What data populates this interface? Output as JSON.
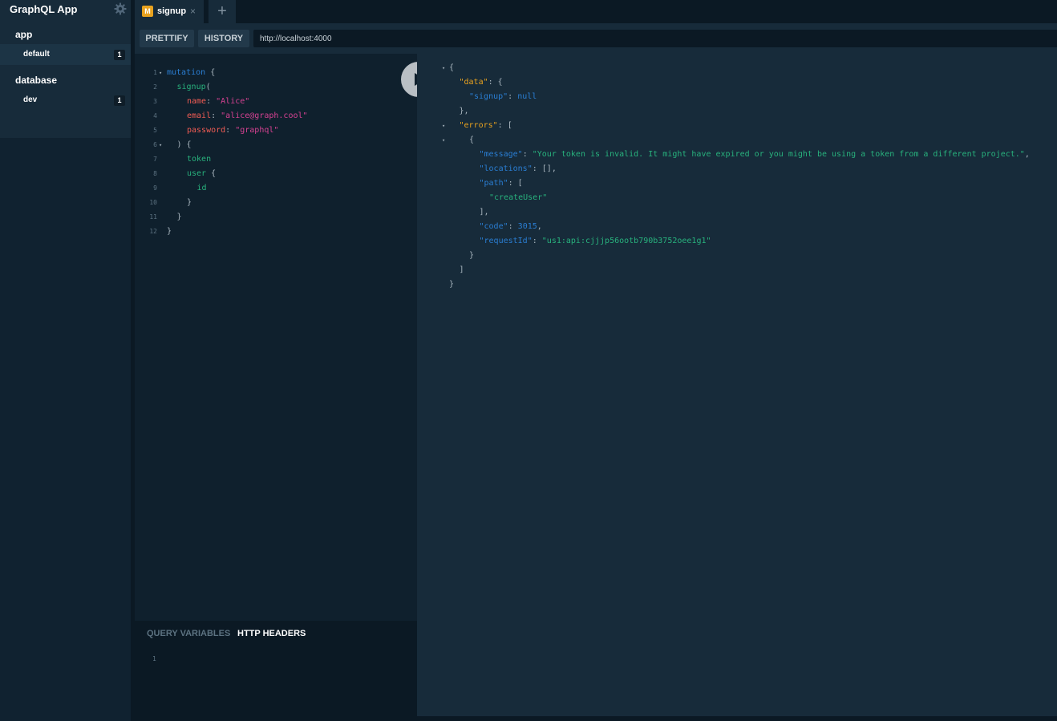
{
  "sidebar": {
    "app_title": "GraphQL App",
    "projects": [
      {
        "name": "app",
        "environment": {
          "label": "default",
          "count": "1"
        }
      },
      {
        "name": "database",
        "environment": {
          "label": "dev",
          "count": "1"
        }
      }
    ]
  },
  "tabs": [
    {
      "icon_letter": "M",
      "label": "signup",
      "close": "×"
    }
  ],
  "tab_add_label": "+",
  "toolbar": {
    "prettify_label": "PRETTIFY",
    "history_label": "HISTORY",
    "endpoint_value": "http://localhost:4000"
  },
  "editor": {
    "lines": [
      {
        "n": "1",
        "fold": true,
        "indent": 0,
        "tokens": [
          [
            "kw",
            "mutation"
          ],
          [
            "punc",
            " {"
          ]
        ]
      },
      {
        "n": "2",
        "fold": false,
        "indent": 1,
        "tokens": [
          [
            "fn",
            "signup"
          ],
          [
            "punc",
            "("
          ]
        ]
      },
      {
        "n": "3",
        "fold": false,
        "indent": 2,
        "tokens": [
          [
            "attr",
            "name"
          ],
          [
            "punc",
            ": "
          ],
          [
            "str",
            "\"Alice\""
          ]
        ]
      },
      {
        "n": "4",
        "fold": false,
        "indent": 2,
        "tokens": [
          [
            "attr",
            "email"
          ],
          [
            "punc",
            ": "
          ],
          [
            "str",
            "\"alice@graph.cool\""
          ]
        ]
      },
      {
        "n": "5",
        "fold": false,
        "indent": 2,
        "tokens": [
          [
            "attr",
            "password"
          ],
          [
            "punc",
            ": "
          ],
          [
            "str",
            "\"graphql\""
          ]
        ]
      },
      {
        "n": "6",
        "fold": true,
        "indent": 1,
        "tokens": [
          [
            "punc",
            ") {"
          ]
        ]
      },
      {
        "n": "7",
        "fold": false,
        "indent": 2,
        "tokens": [
          [
            "fn",
            "token"
          ]
        ]
      },
      {
        "n": "8",
        "fold": false,
        "indent": 2,
        "tokens": [
          [
            "fn",
            "user"
          ],
          [
            "punc",
            " {"
          ]
        ]
      },
      {
        "n": "9",
        "fold": false,
        "indent": 3,
        "tokens": [
          [
            "fn",
            "id"
          ]
        ]
      },
      {
        "n": "10",
        "fold": false,
        "indent": 2,
        "tokens": [
          [
            "punc",
            "}"
          ]
        ]
      },
      {
        "n": "11",
        "fold": false,
        "indent": 1,
        "tokens": [
          [
            "punc",
            "}"
          ]
        ]
      },
      {
        "n": "12",
        "fold": false,
        "indent": 0,
        "tokens": [
          [
            "punc",
            "}"
          ]
        ]
      }
    ]
  },
  "bottom_pane": {
    "query_variables_label": "QUERY VARIABLES",
    "http_headers_label": "HTTP HEADERS",
    "line_number": "1"
  },
  "result": {
    "lines": [
      {
        "fold": true,
        "indent": 0,
        "tokens": [
          [
            "p-grey",
            "{"
          ]
        ]
      },
      {
        "fold": false,
        "indent": 1,
        "tokens": [
          [
            "k-top",
            "\"data\""
          ],
          [
            "p-grey",
            ": {"
          ]
        ]
      },
      {
        "fold": false,
        "indent": 2,
        "tokens": [
          [
            "k-in",
            "\"signup\""
          ],
          [
            "p-grey",
            ": "
          ],
          [
            "n-blue",
            "null"
          ]
        ]
      },
      {
        "fold": false,
        "indent": 1,
        "tokens": [
          [
            "p-grey",
            "},"
          ]
        ]
      },
      {
        "fold": true,
        "indent": 1,
        "tokens": [
          [
            "k-top",
            "\"errors\""
          ],
          [
            "p-grey",
            ": ["
          ]
        ]
      },
      {
        "fold": true,
        "indent": 2,
        "tokens": [
          [
            "p-grey",
            "{"
          ]
        ]
      },
      {
        "fold": false,
        "indent": 3,
        "tokens": [
          [
            "k-in",
            "\"message\""
          ],
          [
            "p-grey",
            ": "
          ],
          [
            "s-grn",
            "\"Your token is invalid. It might have expired or you might be using a token from a different project.\""
          ],
          [
            "p-grey",
            ","
          ]
        ]
      },
      {
        "fold": false,
        "indent": 3,
        "tokens": [
          [
            "k-in",
            "\"locations\""
          ],
          [
            "p-grey",
            ": [],"
          ]
        ]
      },
      {
        "fold": false,
        "indent": 3,
        "tokens": [
          [
            "k-in",
            "\"path\""
          ],
          [
            "p-grey",
            ": ["
          ]
        ]
      },
      {
        "fold": false,
        "indent": 4,
        "tokens": [
          [
            "s-grn",
            "\"createUser\""
          ]
        ]
      },
      {
        "fold": false,
        "indent": 3,
        "tokens": [
          [
            "p-grey",
            "],"
          ]
        ]
      },
      {
        "fold": false,
        "indent": 3,
        "tokens": [
          [
            "k-in",
            "\"code\""
          ],
          [
            "p-grey",
            ": "
          ],
          [
            "n-blue",
            "3015"
          ],
          [
            "p-grey",
            ","
          ]
        ]
      },
      {
        "fold": false,
        "indent": 3,
        "tokens": [
          [
            "k-in",
            "\"requestId\""
          ],
          [
            "p-grey",
            ": "
          ],
          [
            "s-grn",
            "\"us1:api:cjjjp56ootb790b3752oee1g1\""
          ]
        ]
      },
      {
        "fold": false,
        "indent": 2,
        "tokens": [
          [
            "p-grey",
            "}"
          ]
        ]
      },
      {
        "fold": false,
        "indent": 1,
        "tokens": [
          [
            "p-grey",
            "]"
          ]
        ]
      },
      {
        "fold": false,
        "indent": 0,
        "tokens": [
          [
            "p-grey",
            "}"
          ]
        ]
      }
    ]
  },
  "icons": {
    "settings": "gear-icon",
    "run": "play-icon",
    "tab_close": "close-icon",
    "tab_add": "plus-icon",
    "fold": "caret-down-icon"
  }
}
